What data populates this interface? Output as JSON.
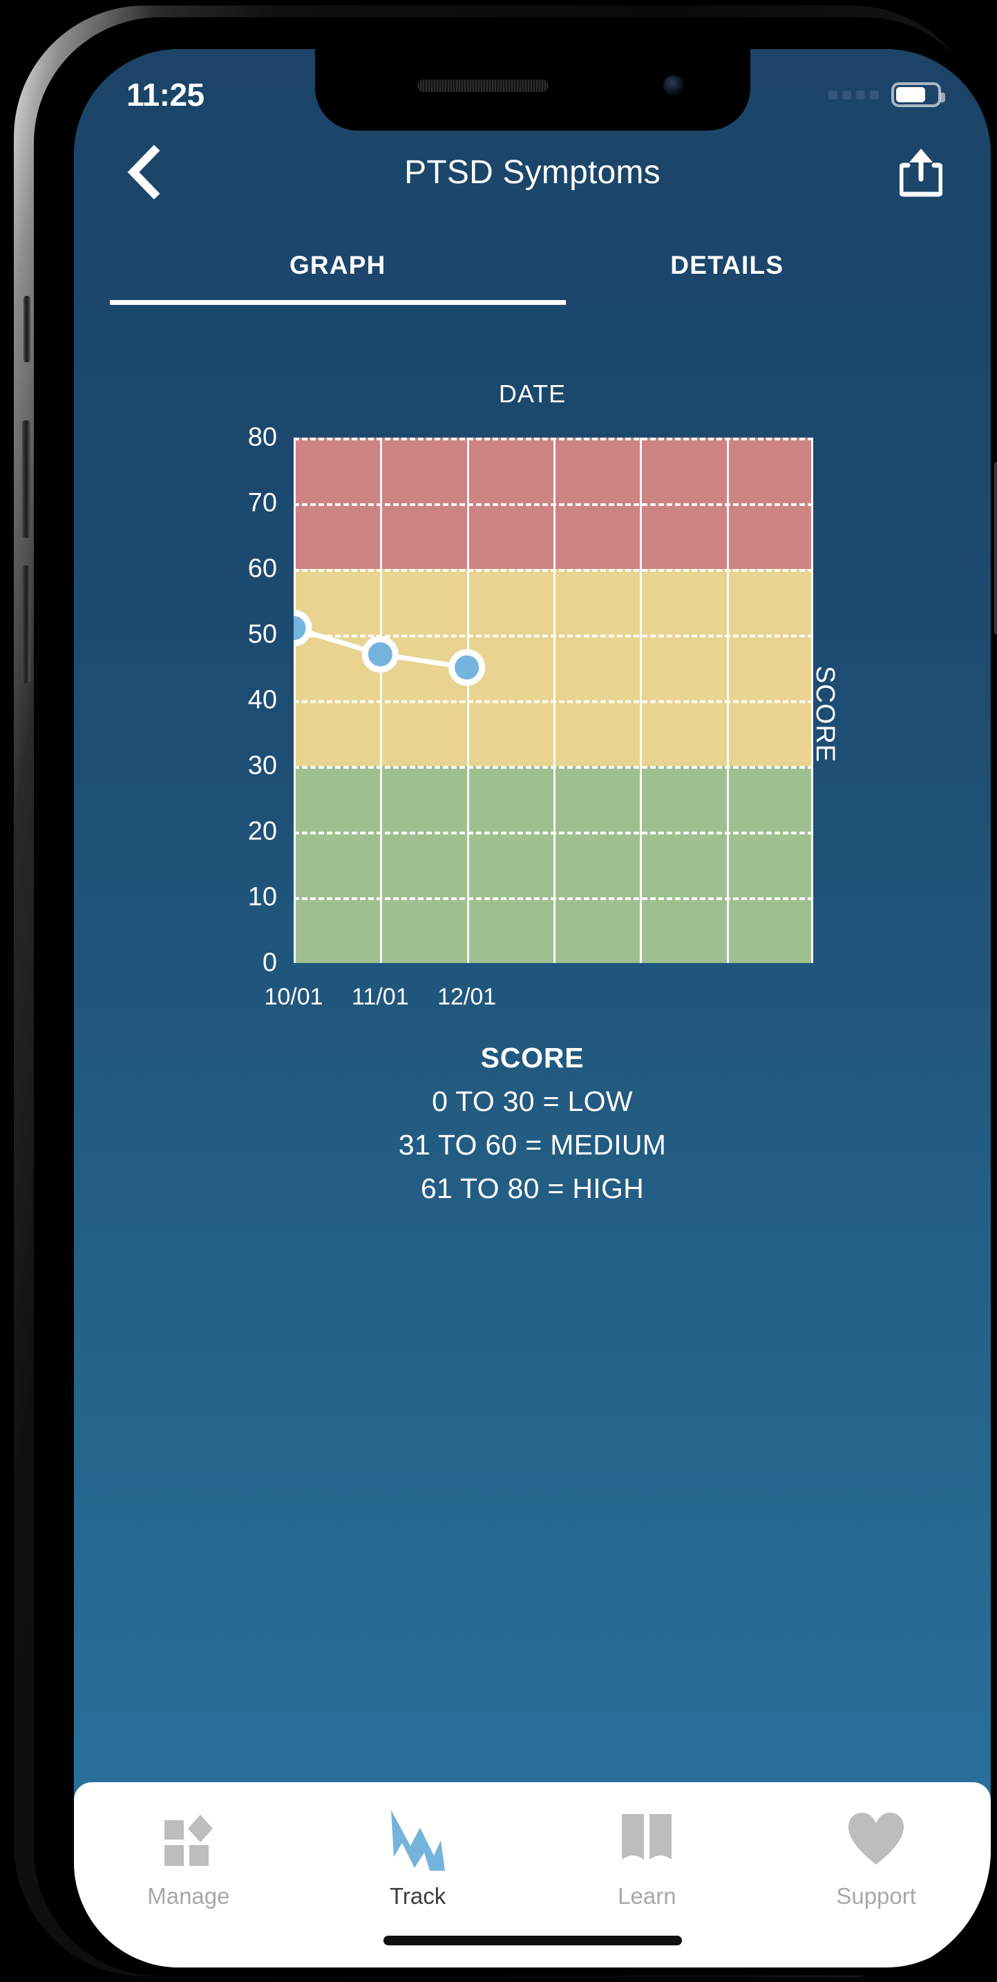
{
  "status_bar": {
    "time": "11:25",
    "signal_icon": "signal-dots-icon",
    "battery_icon": "battery-icon",
    "battery_level_pct": 72
  },
  "nav": {
    "back_icon": "chevron-left-icon",
    "title": "PTSD Symptoms",
    "share_icon": "share-icon"
  },
  "tabs": [
    {
      "label": "GRAPH",
      "active": true
    },
    {
      "label": "DETAILS",
      "active": false
    }
  ],
  "legend": {
    "title": "SCORE",
    "lines": [
      "0 TO 30 = LOW",
      "31 TO 60 = MEDIUM",
      "61 TO 80 = HIGH"
    ]
  },
  "bottom_nav": [
    {
      "label": "Manage",
      "icon": "grid-blocks-icon",
      "active": false
    },
    {
      "label": "Track",
      "icon": "zigzag-trend-icon",
      "active": true
    },
    {
      "label": "Learn",
      "icon": "open-book-icon",
      "active": false
    },
    {
      "label": "Support",
      "icon": "heart-icon",
      "active": false
    }
  ],
  "colors": {
    "background_top": "#1b4468",
    "background_bottom": "#2a74a0",
    "band_high": "#cc8383",
    "band_medium": "#e8d391",
    "band_low": "#9fbf91",
    "point_fill": "#74b4dc",
    "point_stroke": "#ffffff",
    "accent": "#74b4dc",
    "tabbar_background": "#ffffff",
    "tabbar_inactive": "#bdbdbd"
  },
  "chart_data": {
    "type": "line",
    "title": "DATE",
    "xlabel": "DATE",
    "ylabel": "SCORE",
    "ylim": [
      0,
      80
    ],
    "yticks": [
      0,
      10,
      20,
      30,
      40,
      50,
      60,
      70,
      80
    ],
    "grid": true,
    "legend_position": "below",
    "x": [
      "10/01",
      "11/01",
      "12/01"
    ],
    "xtick_labels": [
      "10/01",
      "11/01",
      "12/01"
    ],
    "columns": 6,
    "series": [
      {
        "name": "Score",
        "values": [
          51,
          47,
          45
        ]
      }
    ],
    "bands": [
      {
        "label": "LOW",
        "from": 0,
        "to": 30,
        "color": "#9fbf91"
      },
      {
        "label": "MEDIUM",
        "from": 30,
        "to": 60,
        "color": "#e8d391"
      },
      {
        "label": "HIGH",
        "from": 60,
        "to": 80,
        "color": "#cc8383"
      }
    ]
  }
}
